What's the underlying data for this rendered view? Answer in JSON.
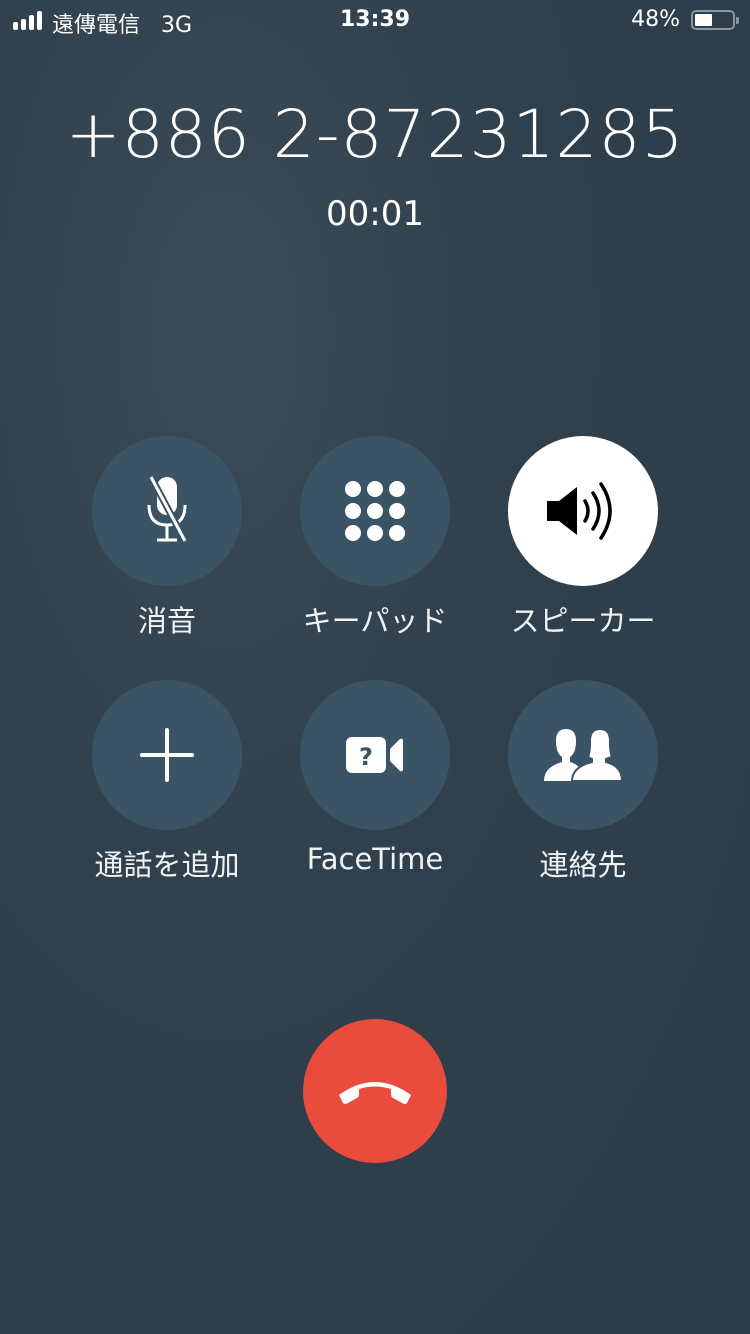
{
  "status_bar": {
    "carrier": "遠傳電信",
    "network": "3G",
    "time": "13:39",
    "battery_percent": "48%",
    "battery_level": 0.48,
    "signal_bars": 4
  },
  "call": {
    "number": "+886 2-87231285",
    "duration": "00:01"
  },
  "buttons": [
    {
      "label": "消音",
      "icon": "mute-icon",
      "active": false
    },
    {
      "label": "キーパッド",
      "icon": "keypad-icon",
      "active": false
    },
    {
      "label": "スピーカー",
      "icon": "speaker-icon",
      "active": true
    },
    {
      "label": "通話を追加",
      "icon": "plus-icon",
      "active": false
    },
    {
      "label": "FaceTime",
      "icon": "facetime-icon",
      "active": false
    },
    {
      "label": "連絡先",
      "icon": "contacts-icon",
      "active": false
    }
  ],
  "end_call": {
    "icon": "end-call-icon",
    "color": "#e94b3c"
  },
  "colors": {
    "background": "#2f3f4b",
    "button": "#3a5466",
    "active_button": "#ffffff"
  }
}
